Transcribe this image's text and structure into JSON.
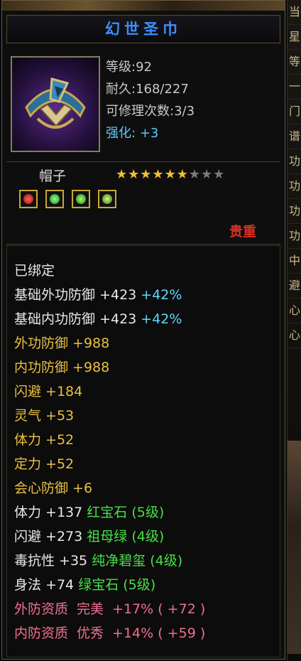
{
  "item": {
    "name": "幻世圣巾",
    "level": "等级:92",
    "durability": "耐久:168/227",
    "repairs": "可修理次数:3/3",
    "enhance_label": "强化:",
    "enhance_value": "+3",
    "type": "帽子",
    "stars_total": 9,
    "stars_filled": 6,
    "precious": "贵重",
    "gem_icons": [
      "red-gem-icon",
      "green-gem-icon",
      "green-gem-icon",
      "dragon-gem-icon"
    ]
  },
  "attributes": {
    "bound": "已绑定",
    "base_ext_def": {
      "label": "基础外功防御",
      "value": "+423",
      "bonus": "+42%"
    },
    "base_int_def": {
      "label": "基础内功防御",
      "value": "+423",
      "bonus": "+42%"
    },
    "ext_def": "外功防御 +988",
    "int_def": "内功防御 +988",
    "dodge": "闪避 +184",
    "spirit": "灵气 +53",
    "stamina": "体力 +52",
    "focus": "定力 +52",
    "crit_def": "会心防御 +6",
    "gem1": {
      "stat": "体力 +137",
      "gem": "红宝石 (5级)"
    },
    "gem2": {
      "stat": "闪避 +273",
      "gem": "祖母绿 (4级)"
    },
    "gem3": {
      "stat": "毒抗性 +35",
      "gem": "纯净碧玺 (4级)"
    },
    "gem4": {
      "stat": "身法 +74",
      "gem": "绿宝石 (5级)"
    },
    "q1": {
      "label": "外防资质",
      "grade": "完美",
      "pct": "+17%",
      "bonus": "( +72 )"
    },
    "q2": {
      "label": "内防资质",
      "grade": "优秀",
      "pct": "+14%",
      "bonus": "( +59 )"
    }
  },
  "side_labels": [
    "当",
    "星",
    "等",
    "一",
    "门",
    "谱",
    "功",
    "功",
    "功",
    "功",
    "中",
    "避",
    "心",
    "心"
  ],
  "colors": {
    "title": "#3f8dff",
    "gold": "#e8c040",
    "green": "#48e048",
    "cyan": "#60d8ff",
    "pink": "#f07090",
    "precious": "#e03020"
  }
}
